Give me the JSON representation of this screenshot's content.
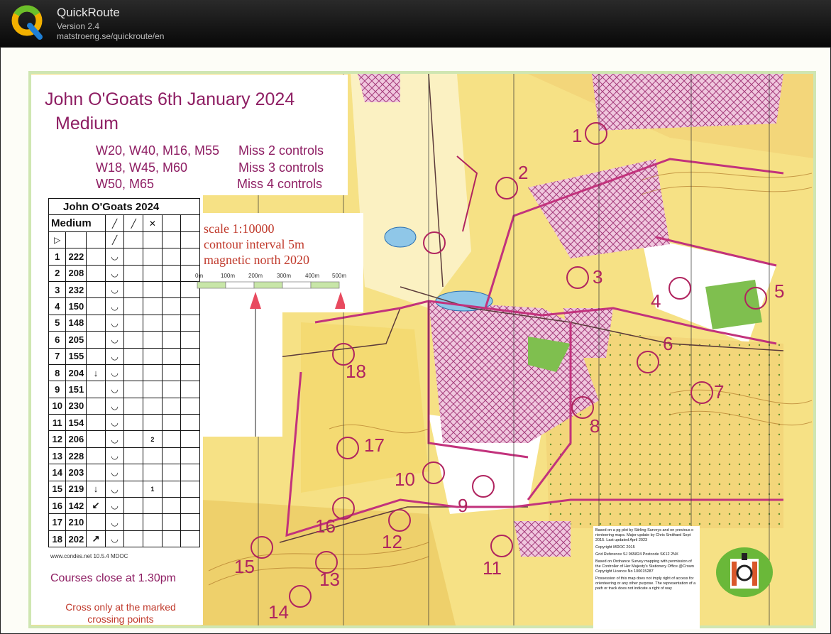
{
  "app": {
    "title": "QuickRoute",
    "version": "Version 2.4",
    "url": "matstroeng.se/quickroute/en"
  },
  "map": {
    "event_title": "John O'Goats 6th January 2024",
    "course": "Medium",
    "classes": [
      {
        "groups": "W20, W40, M16, M55",
        "rule": "Miss 2 controls"
      },
      {
        "groups": "W18, W45, M60",
        "rule": "Miss 3 controls"
      },
      {
        "groups": "W50, M65",
        "rule": "Miss 4 controls"
      }
    ],
    "scale": {
      "line1": "scale 1:10000",
      "line2": "contour interval 5m",
      "line3": "magnetic north 2020",
      "bar_labels": [
        "0m",
        "100m",
        "200m",
        "300m",
        "400m",
        "500m"
      ]
    },
    "descriptions": {
      "title": "John O'Goats 2024",
      "course": "Medium",
      "rows": [
        {
          "n": "1",
          "code": "222",
          "dir": "",
          "extra": "",
          "dim": "",
          "loc": ""
        },
        {
          "n": "2",
          "code": "208",
          "dir": "",
          "extra": "",
          "dim": "",
          "loc": ""
        },
        {
          "n": "3",
          "code": "232",
          "dir": "",
          "extra": "",
          "dim": "",
          "loc": ""
        },
        {
          "n": "4",
          "code": "150",
          "dir": "",
          "extra": "",
          "dim": "",
          "loc": ""
        },
        {
          "n": "5",
          "code": "148",
          "dir": "",
          "extra": "",
          "dim": "",
          "loc": ""
        },
        {
          "n": "6",
          "code": "205",
          "dir": "",
          "extra": "",
          "dim": "",
          "loc": ""
        },
        {
          "n": "7",
          "code": "155",
          "dir": "",
          "extra": "",
          "dim": "",
          "loc": ""
        },
        {
          "n": "8",
          "code": "204",
          "dir": "↓",
          "extra": "",
          "dim": "",
          "loc": ""
        },
        {
          "n": "9",
          "code": "151",
          "dir": "",
          "extra": "",
          "dim": "",
          "loc": ""
        },
        {
          "n": "10",
          "code": "230",
          "dir": "",
          "extra": "",
          "dim": "",
          "loc": ""
        },
        {
          "n": "11",
          "code": "154",
          "dir": "",
          "extra": "",
          "dim": "",
          "loc": ""
        },
        {
          "n": "12",
          "code": "206",
          "dir": "",
          "extra": "",
          "dim": "2",
          "loc": ""
        },
        {
          "n": "13",
          "code": "228",
          "dir": "",
          "extra": "",
          "dim": "",
          "loc": ""
        },
        {
          "n": "14",
          "code": "203",
          "dir": "",
          "extra": "",
          "dim": "",
          "loc": ""
        },
        {
          "n": "15",
          "code": "219",
          "dir": "↓",
          "extra": "",
          "dim": "1",
          "loc": ""
        },
        {
          "n": "16",
          "code": "142",
          "dir": "↙",
          "extra": "",
          "dim": "",
          "loc": ""
        },
        {
          "n": "17",
          "code": "210",
          "dir": "",
          "extra": "",
          "dim": "",
          "loc": ""
        },
        {
          "n": "18",
          "code": "202",
          "dir": "↗",
          "extra": "",
          "dim": "",
          "loc": ""
        }
      ]
    },
    "footnote": "www.condes.net 10.5.4 MDOC",
    "courses_close": "Courses close at 1.30pm",
    "cross_line1": "Cross only at the marked",
    "cross_line2": "crossing points",
    "controls": [
      "1",
      "2",
      "3",
      "4",
      "5",
      "6",
      "7",
      "8",
      "9",
      "10",
      "11",
      "12",
      "13",
      "14",
      "15",
      "16",
      "17",
      "18"
    ],
    "info": {
      "p1": "Based on a pg plot by Stirling Surveys and on previous o rienteering maps. Major update by Chris Smithard Sept 2015. Last updated April 2023",
      "p2": "Copyright MDOC 2015",
      "p3": "Grid Reference SJ 965824 Postcode SK12 2NX",
      "p4": "Based on Ordnance Survey mapping with permission of the Controller of Her Majesty's Stationery Office @Crown Copyright Licence No 100015287",
      "p5": "Possession of this map does not imply right of access for orienteering or any other purpose. The representation of a path or track does not indicate a right of way"
    },
    "club_logo_text": "MDOC"
  },
  "colors": {
    "course": "#b0245f",
    "title": "#8e1e63",
    "warning": "#c0392b",
    "open_land": "#f6e27a",
    "rough": "#fbf1b8",
    "forest": "#ffffff",
    "oob": "#d98cb8"
  }
}
